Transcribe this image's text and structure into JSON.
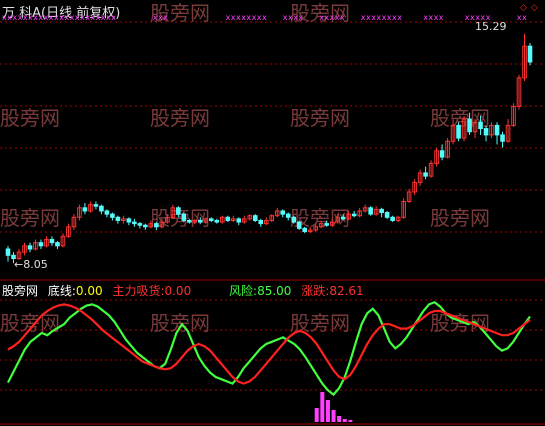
{
  "header": {
    "title": "万 科A(日线 前复权)",
    "title_color": "#e0e0e0"
  },
  "markers": {
    "high_label": "15.29",
    "low_label": "8.05",
    "diamond_color": "#ff2020",
    "cross_color": "#ff40ff"
  },
  "indicator": {
    "name": "股旁网",
    "items": [
      {
        "label": "底线:",
        "value": "0.00",
        "color": "#ffff00",
        "label_color": "#ffffff"
      },
      {
        "label": "主力吸货:",
        "value": "0.00",
        "color": "#ff3030",
        "label_color": "#ff3030"
      },
      {
        "label": "风险:",
        "value": "85.00",
        "color": "#40ff40",
        "label_color": "#40ff40"
      },
      {
        "label": "涨跌:",
        "value": "82.61",
        "color": "#ff3030",
        "label_color": "#ff3030"
      }
    ]
  },
  "watermark": "股旁网",
  "colors": {
    "up": "#ff3232",
    "down": "#54fcfc",
    "risk_line": "#40ff40",
    "change_line": "#ff2020",
    "bars": "#ff40ff",
    "grid": "#a00000",
    "watermark": "#7a3a3a"
  },
  "chart_data": {
    "type": "candlestick_with_indicator",
    "price_range": [
      8.05,
      15.29
    ],
    "candles": [
      [
        8.5,
        8.3,
        8.6,
        8.1
      ],
      [
        8.3,
        8.2,
        8.4,
        8.05
      ],
      [
        8.2,
        8.4,
        8.5,
        8.15
      ],
      [
        8.4,
        8.6,
        8.7,
        8.3
      ],
      [
        8.6,
        8.5,
        8.7,
        8.4
      ],
      [
        8.5,
        8.7,
        8.8,
        8.45
      ],
      [
        8.7,
        8.6,
        8.8,
        8.5
      ],
      [
        8.6,
        8.8,
        8.9,
        8.55
      ],
      [
        8.8,
        8.7,
        8.9,
        8.6
      ],
      [
        8.7,
        8.6,
        8.75,
        8.5
      ],
      [
        8.6,
        8.9,
        9.0,
        8.55
      ],
      [
        8.9,
        9.2,
        9.3,
        8.85
      ],
      [
        9.2,
        9.5,
        9.6,
        9.1
      ],
      [
        9.5,
        9.8,
        9.9,
        9.4
      ],
      [
        9.8,
        9.7,
        9.95,
        9.6
      ],
      [
        9.7,
        9.9,
        10.0,
        9.65
      ],
      [
        9.9,
        9.85,
        10.0,
        9.75
      ],
      [
        9.85,
        9.7,
        9.9,
        9.6
      ],
      [
        9.7,
        9.6,
        9.75,
        9.5
      ],
      [
        9.6,
        9.5,
        9.65,
        9.4
      ],
      [
        9.5,
        9.4,
        9.55,
        9.3
      ],
      [
        9.4,
        9.45,
        9.55,
        9.3
      ],
      [
        9.45,
        9.35,
        9.5,
        9.25
      ],
      [
        9.35,
        9.3,
        9.45,
        9.2
      ],
      [
        9.3,
        9.25,
        9.35,
        9.15
      ],
      [
        9.25,
        9.2,
        9.3,
        9.1
      ],
      [
        9.2,
        9.3,
        9.4,
        9.15
      ],
      [
        9.3,
        9.2,
        9.35,
        9.1
      ],
      [
        9.2,
        9.35,
        9.45,
        9.15
      ],
      [
        9.35,
        9.5,
        9.6,
        9.3
      ],
      [
        9.5,
        9.8,
        9.9,
        9.45
      ],
      [
        9.8,
        9.6,
        9.85,
        9.5
      ],
      [
        9.6,
        9.4,
        9.65,
        9.35
      ],
      [
        9.4,
        9.35,
        9.45,
        9.3
      ],
      [
        9.35,
        9.4,
        9.45,
        9.3
      ],
      [
        9.4,
        9.35,
        9.5,
        9.3
      ],
      [
        9.35,
        9.45,
        9.5,
        9.3
      ],
      [
        9.45,
        9.4,
        9.5,
        9.35
      ],
      [
        9.4,
        9.35,
        9.45,
        9.3
      ],
      [
        9.35,
        9.5,
        9.55,
        9.3
      ],
      [
        9.5,
        9.4,
        9.55,
        9.35
      ],
      [
        9.4,
        9.45,
        9.55,
        9.35
      ],
      [
        9.45,
        9.35,
        9.5,
        9.25
      ],
      [
        9.35,
        9.45,
        9.55,
        9.3
      ],
      [
        9.45,
        9.55,
        9.6,
        9.4
      ],
      [
        9.55,
        9.4,
        9.6,
        9.35
      ],
      [
        9.4,
        9.3,
        9.45,
        9.2
      ],
      [
        9.3,
        9.4,
        9.5,
        9.25
      ],
      [
        9.4,
        9.55,
        9.6,
        9.35
      ],
      [
        9.55,
        9.7,
        9.8,
        9.5
      ],
      [
        9.7,
        9.6,
        9.75,
        9.5
      ],
      [
        9.6,
        9.5,
        9.65,
        9.4
      ],
      [
        9.5,
        9.35,
        9.55,
        9.3
      ],
      [
        9.35,
        9.15,
        9.4,
        9.1
      ],
      [
        9.15,
        9.05,
        9.2,
        9.0
      ],
      [
        9.05,
        9.1,
        9.2,
        9.0
      ],
      [
        9.1,
        9.2,
        9.3,
        9.05
      ],
      [
        9.2,
        9.3,
        9.4,
        9.15
      ],
      [
        9.3,
        9.25,
        9.4,
        9.2
      ],
      [
        9.25,
        9.35,
        9.45,
        9.2
      ],
      [
        9.35,
        9.5,
        9.6,
        9.3
      ],
      [
        9.5,
        9.45,
        9.6,
        9.4
      ],
      [
        9.45,
        9.6,
        9.7,
        9.4
      ],
      [
        9.6,
        9.55,
        9.7,
        9.5
      ],
      [
        9.55,
        9.7,
        9.8,
        9.5
      ],
      [
        9.7,
        9.8,
        9.9,
        9.65
      ],
      [
        9.8,
        9.6,
        9.85,
        9.55
      ],
      [
        9.6,
        9.75,
        9.85,
        9.55
      ],
      [
        9.75,
        9.65,
        9.8,
        9.5
      ],
      [
        9.65,
        9.5,
        9.7,
        9.45
      ],
      [
        9.5,
        9.4,
        9.55,
        9.35
      ],
      [
        9.4,
        9.5,
        9.55,
        9.35
      ],
      [
        9.5,
        10.0,
        10.1,
        9.45
      ],
      [
        10.0,
        10.3,
        10.4,
        9.95
      ],
      [
        10.3,
        10.6,
        10.7,
        10.2
      ],
      [
        10.6,
        10.9,
        11.0,
        10.5
      ],
      [
        10.9,
        10.8,
        11.1,
        10.7
      ],
      [
        10.8,
        11.2,
        11.3,
        10.75
      ],
      [
        11.2,
        11.6,
        11.7,
        11.1
      ],
      [
        11.6,
        11.4,
        11.8,
        11.3
      ],
      [
        11.4,
        11.9,
        12.0,
        11.35
      ],
      [
        11.9,
        12.4,
        12.6,
        11.8
      ],
      [
        12.4,
        12.0,
        12.5,
        11.9
      ],
      [
        12.0,
        12.6,
        12.7,
        11.9
      ],
      [
        12.6,
        12.2,
        12.8,
        12.1
      ],
      [
        12.2,
        12.5,
        12.6,
        12.0
      ],
      [
        12.5,
        12.3,
        12.7,
        12.1
      ],
      [
        12.3,
        12.1,
        12.4,
        11.9
      ],
      [
        12.1,
        12.4,
        12.5,
        12.0
      ],
      [
        12.4,
        12.1,
        12.5,
        11.8
      ],
      [
        12.1,
        11.9,
        12.2,
        11.7
      ],
      [
        11.9,
        12.4,
        12.6,
        11.85
      ],
      [
        12.4,
        13.0,
        13.1,
        12.35
      ],
      [
        13.0,
        13.9,
        14.0,
        12.9
      ],
      [
        13.9,
        14.9,
        15.29,
        13.8
      ],
      [
        14.9,
        14.4,
        15.0,
        14.3
      ]
    ],
    "risk": [
      25,
      35,
      45,
      55,
      62,
      66,
      70,
      68,
      72,
      75,
      78,
      84,
      88,
      92,
      95,
      96,
      94,
      90,
      86,
      80,
      72,
      64,
      58,
      52,
      48,
      44,
      40,
      38,
      42,
      55,
      70,
      78,
      72,
      60,
      48,
      40,
      34,
      30,
      28,
      26,
      24,
      30,
      38,
      44,
      50,
      56,
      60,
      62,
      64,
      66,
      63,
      60,
      55,
      48,
      40,
      32,
      24,
      18,
      14,
      20,
      30,
      45,
      62,
      78,
      88,
      92,
      86,
      74,
      62,
      56,
      60,
      66,
      74,
      82,
      90,
      96,
      98,
      94,
      88,
      84,
      82,
      80,
      78,
      80,
      76,
      70,
      64,
      58,
      54,
      56,
      62,
      70,
      78,
      85
    ],
    "change": [
      55,
      58,
      62,
      68,
      74,
      80,
      86,
      90,
      93,
      95,
      96,
      95,
      93,
      90,
      86,
      82,
      77,
      72,
      68,
      64,
      60,
      56,
      52,
      48,
      44,
      42,
      40,
      38,
      37,
      38,
      42,
      48,
      54,
      58,
      60,
      58,
      54,
      48,
      42,
      36,
      30,
      26,
      24,
      26,
      30,
      36,
      42,
      48,
      54,
      60,
      66,
      70,
      72,
      70,
      66,
      60,
      52,
      44,
      36,
      30,
      28,
      32,
      40,
      50,
      60,
      68,
      74,
      78,
      78,
      76,
      74,
      74,
      76,
      80,
      84,
      88,
      90,
      90,
      88,
      86,
      84,
      82,
      80,
      78,
      76,
      74,
      72,
      70,
      68,
      68,
      70,
      74,
      78,
      82
    ],
    "bars": [
      [
        55,
        14
      ],
      [
        56,
        30
      ],
      [
        57,
        22
      ],
      [
        58,
        12
      ],
      [
        59,
        6
      ],
      [
        60,
        3
      ],
      [
        61,
        2
      ]
    ],
    "risk_value": 85.0,
    "change_value": 82.61
  }
}
